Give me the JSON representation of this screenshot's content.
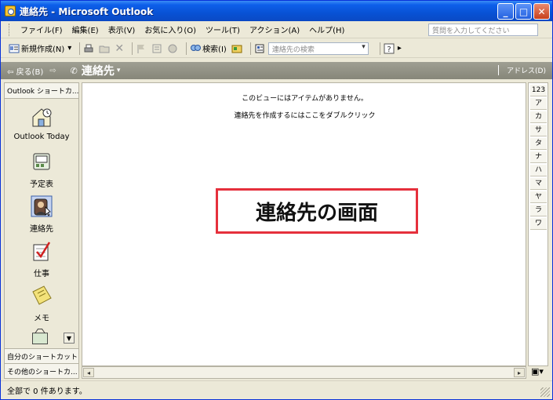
{
  "window": {
    "title": "連絡先 - Microsoft Outlook",
    "min_glyph": "_",
    "max_glyph": "□",
    "close_glyph": "✕"
  },
  "menu": {
    "items": [
      "ファイル(F)",
      "編集(E)",
      "表示(V)",
      "お気に入り(O)",
      "ツール(T)",
      "アクション(A)",
      "ヘルプ(H)"
    ],
    "help_placeholder": "質問を入力してください"
  },
  "toolbar": {
    "new_label": "新規作成(N)",
    "search_label": "検索(I)",
    "contact_search_placeholder": "連絡先の検索"
  },
  "navbar": {
    "back": "戻る(B)",
    "title": "連絡先",
    "address": "アドレス(D)"
  },
  "outlook_bar": {
    "header": "Outlook ショートカ...",
    "items": [
      {
        "label": "Outlook Today",
        "icon": "outlook-today-icon"
      },
      {
        "label": "予定表",
        "icon": "calendar-icon"
      },
      {
        "label": "連絡先",
        "icon": "contacts-icon"
      },
      {
        "label": "仕事",
        "icon": "tasks-icon"
      },
      {
        "label": "メモ",
        "icon": "notes-icon"
      }
    ],
    "footer1": "自分のショートカット",
    "footer2": "その他のショートカ..."
  },
  "content": {
    "empty_line1": "このビューにはアイテムがありません。",
    "empty_line2": "連絡先を作成するにはここをダブルクリック",
    "annotation": "連絡先の画面"
  },
  "index_letters": [
    "123",
    "ア",
    "カ",
    "サ",
    "タ",
    "ナ",
    "ハ",
    "マ",
    "ヤ",
    "ラ",
    "ワ"
  ],
  "status": {
    "text": "全部で 0 件あります。"
  },
  "colors": {
    "annotation_border": "#E5303C",
    "title_bar": "#0852D5"
  }
}
